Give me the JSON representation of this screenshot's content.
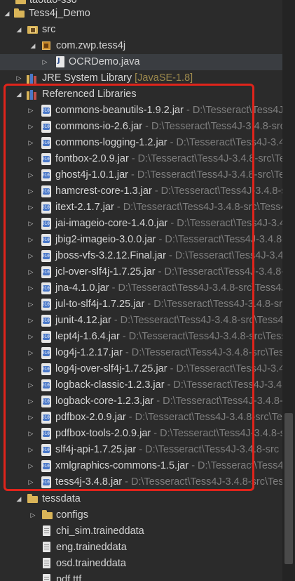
{
  "tree": {
    "cut_item": "taotao-sso",
    "project": "Tess4j_Demo",
    "src_folder": "src",
    "package": "com.zwp.tess4j",
    "java_file": "OCRDemo.java",
    "jre_label": "JRE System Library",
    "jre_version": "[JavaSE-1.8]",
    "ref_libs": "Referenced Libraries",
    "jars": [
      {
        "name": "commons-beanutils-1.9.2.jar",
        "path": " - D:\\Tesseract\\Tess4J-3.4.8-src"
      },
      {
        "name": "commons-io-2.6.jar",
        "path": " - D:\\Tesseract\\Tess4J-3.4.8-src\\Tess4J\\lib"
      },
      {
        "name": "commons-logging-1.2.jar",
        "path": " - D:\\Tesseract\\Tess4J-3.4.8-src"
      },
      {
        "name": "fontbox-2.0.9.jar",
        "path": " - D:\\Tesseract\\Tess4J-3.4.8-src\\Tess4J"
      },
      {
        "name": "ghost4j-1.0.1.jar",
        "path": " - D:\\Tesseract\\Tess4J-3.4.8-src\\Tess4J"
      },
      {
        "name": "hamcrest-core-1.3.jar",
        "path": " - D:\\Tesseract\\Tess4J-3.4.8-src"
      },
      {
        "name": "itext-2.1.7.jar",
        "path": " - D:\\Tesseract\\Tess4J-3.4.8-src\\Tess4J\\lib"
      },
      {
        "name": "jai-imageio-core-1.4.0.jar",
        "path": " - D:\\Tesseract\\Tess4J-3.4.8-src"
      },
      {
        "name": "jbig2-imageio-3.0.0.jar",
        "path": " - D:\\Tesseract\\Tess4J-3.4.8-src"
      },
      {
        "name": "jboss-vfs-3.2.12.Final.jar",
        "path": " - D:\\Tesseract\\Tess4J-3.4.8-src"
      },
      {
        "name": "jcl-over-slf4j-1.7.25.jar",
        "path": " - D:\\Tesseract\\Tess4J-3.4.8-src"
      },
      {
        "name": "jna-4.1.0.jar",
        "path": " - D:\\Tesseract\\Tess4J-3.4.8-src\\Tess4J\\lib"
      },
      {
        "name": "jul-to-slf4j-1.7.25.jar",
        "path": " - D:\\Tesseract\\Tess4J-3.4.8-src"
      },
      {
        "name": "junit-4.12.jar",
        "path": " - D:\\Tesseract\\Tess4J-3.4.8-src\\Tess4J\\lib"
      },
      {
        "name": "lept4j-1.6.4.jar",
        "path": " - D:\\Tesseract\\Tess4J-3.4.8-src\\Tess4J"
      },
      {
        "name": "log4j-1.2.17.jar",
        "path": " - D:\\Tesseract\\Tess4J-3.4.8-src\\Tess4J"
      },
      {
        "name": "log4j-over-slf4j-1.7.25.jar",
        "path": " - D:\\Tesseract\\Tess4J-3.4.8-src"
      },
      {
        "name": "logback-classic-1.2.3.jar",
        "path": " - D:\\Tesseract\\Tess4J-3.4.8-src"
      },
      {
        "name": "logback-core-1.2.3.jar",
        "path": " - D:\\Tesseract\\Tess4J-3.4.8-src"
      },
      {
        "name": "pdfbox-2.0.9.jar",
        "path": " - D:\\Tesseract\\Tess4J-3.4.8-src\\Tess4J"
      },
      {
        "name": "pdfbox-tools-2.0.9.jar",
        "path": " - D:\\Tesseract\\Tess4J-3.4.8-src"
      },
      {
        "name": "slf4j-api-1.7.25.jar",
        "path": " - D:\\Tesseract\\Tess4J-3.4.8-src"
      },
      {
        "name": "xmlgraphics-commons-1.5.jar",
        "path": " - D:\\Tesseract\\Tess4J-3.4.8-src"
      },
      {
        "name": "tess4j-3.4.8.jar",
        "path": " - D:\\Tesseract\\Tess4J-3.4.8-src\\Tess4J"
      }
    ],
    "tessdata_folder": "tessdata",
    "configs_folder": "configs",
    "data_files": [
      "chi_sim.traineddata",
      "eng.traineddata",
      "osd.traineddata",
      "pdf.ttf"
    ]
  },
  "icons": {
    "expanded": "triangle-down-icon",
    "collapsed": "triangle-right-icon",
    "jar": "jar-icon",
    "folder": "folder-icon"
  },
  "colors": {
    "background": "#2b2b2b",
    "text": "#d4d4d4",
    "path_text": "#7f7f7f",
    "jre_version": "#9e8a4d",
    "highlight": "#e0241b"
  }
}
